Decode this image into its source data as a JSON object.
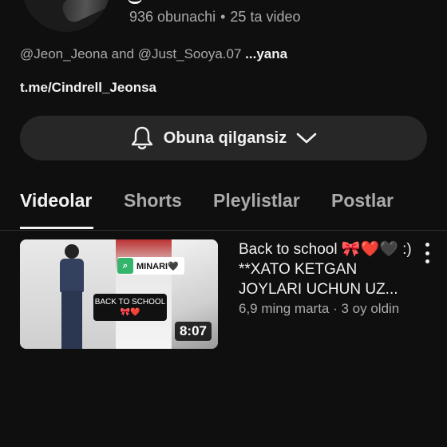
{
  "channel": {
    "subscribers": "936 obunachi",
    "videos_count": "25 ta video",
    "separator": "•",
    "description": "@Jeon_Jeona and @Just_Sooya.07",
    "more": "...yana",
    "link": "t.me/Cindrell_Jeonsa"
  },
  "subscribe": {
    "label": "Obuna qilgansiz",
    "icon": "bell-icon",
    "dropdown_icon": "chevron-down-icon"
  },
  "tabs": [
    {
      "label": "Videolar",
      "active": true
    },
    {
      "label": "Shorts",
      "active": false
    },
    {
      "label": "Pleylistlar",
      "active": false
    },
    {
      "label": "Postlar",
      "active": false
    }
  ],
  "videos": [
    {
      "title": "Back to school 🎀❤️🖤 :) **XATO KETGAN JOYLARI UCHUN UZ...",
      "meta": "6,9 ming marta · 3 oy oldin",
      "duration": "8:07",
      "thumb_tag": "MINARI🖤",
      "thumb_caption": "BACK TO SCHOOL 🎀❤️"
    }
  ],
  "colors": {
    "background": "#0f0f0f",
    "button": "#272727",
    "text_primary": "#f1f1f1",
    "text_secondary": "#aaaaaa"
  }
}
